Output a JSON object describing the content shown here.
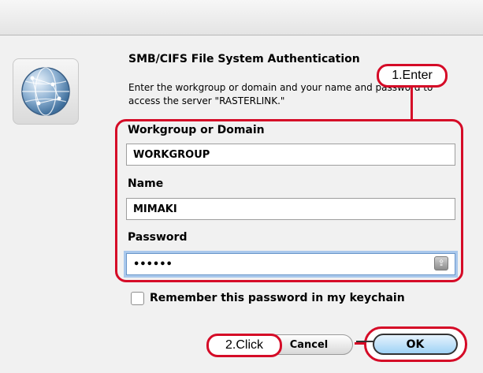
{
  "dialog": {
    "title": "SMB/CIFS File System Authentication",
    "description": "Enter the workgroup or domain and your name and password to access the server \"RASTERLINK.\""
  },
  "form": {
    "workgroup_label": "Workgroup or Domain",
    "workgroup_value": "WORKGROUP",
    "name_label": "Name",
    "name_value": "MIMAKI",
    "password_label": "Password",
    "password_value": "••••••"
  },
  "options": {
    "remember_label": "Remember this password in my keychain",
    "remember_checked": false
  },
  "buttons": {
    "cancel": "Cancel",
    "ok": "OK"
  },
  "annotations": {
    "step1": "1.Enter",
    "step2": "2.Click"
  },
  "colors": {
    "annotation_red": "#d50b27",
    "focus_blue": "#a9c8ec",
    "ok_blue": "#9fd2f5"
  },
  "icons": {
    "app_icon": "network-globe-icon",
    "keychain_icon": "keychain-icon"
  }
}
